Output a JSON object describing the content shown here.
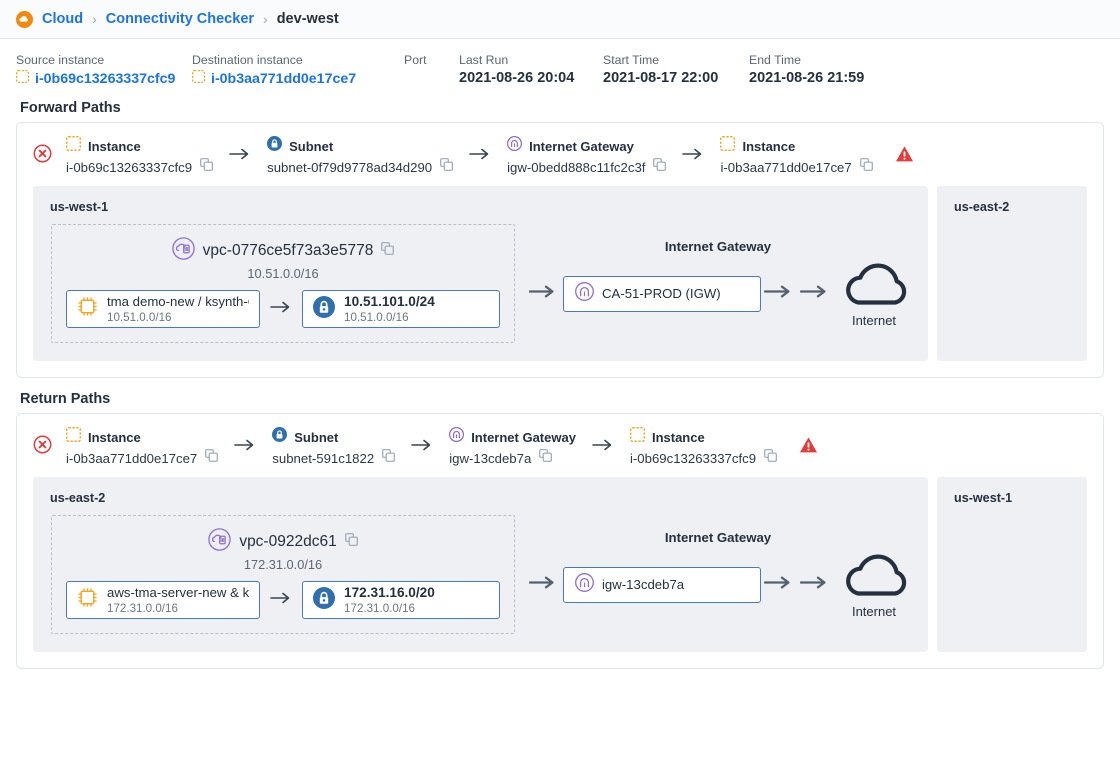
{
  "breadcrumb": {
    "logo_icon": "cloud-logo-icon",
    "items": [
      {
        "label": "Cloud",
        "type": "link"
      },
      {
        "label": "Connectivity Checker",
        "type": "link"
      },
      {
        "label": "dev-west",
        "type": "current"
      }
    ],
    "separator": "›"
  },
  "meta": {
    "source": {
      "label": "Source instance",
      "value": "i-0b69c13263337cfc9",
      "icon": "instance-icon"
    },
    "destination": {
      "label": "Destination instance",
      "value": "i-0b3aa771dd0e17ce7",
      "icon": "instance-icon"
    },
    "port": {
      "label": "Port",
      "value": ""
    },
    "last_run": {
      "label": "Last Run",
      "value": "2021-08-26 20:04"
    },
    "start_time": {
      "label": "Start Time",
      "value": "2021-08-17 22:00"
    },
    "end_time": {
      "label": "End Time",
      "value": "2021-08-26 21:59"
    }
  },
  "forward": {
    "title": "Forward Paths",
    "status_icon": "error-circle-icon",
    "warning_icon": "warning-triangle-icon",
    "hops": [
      {
        "type": "Instance",
        "id": "i-0b69c13263337cfc9",
        "icon": "instance-icon"
      },
      {
        "type": "Subnet",
        "id": "subnet-0f79d9778ad34d290",
        "icon": "subnet-lock-icon"
      },
      {
        "type": "Internet Gateway",
        "id": "igw-0bedd888c11fc2c3f",
        "icon": "internet-gateway-icon"
      },
      {
        "type": "Instance",
        "id": "i-0b3aa771dd0e17ce7",
        "icon": "instance-icon"
      }
    ],
    "region": "us-west-1",
    "vpc": {
      "name": "vpc-0776ce5f73a3e5778",
      "cidr": "10.51.0.0/16",
      "icon": "vpc-icon"
    },
    "instance_node": {
      "name": "tma demo-new / ksynth-CA",
      "cidr": "10.51.0.0/16",
      "icon": "instance-chip-icon"
    },
    "subnet_node": {
      "name": "10.51.101.0/24",
      "cidr": "10.51.0.0/16",
      "icon": "subnet-lock-icon"
    },
    "igw": {
      "label": "Internet Gateway",
      "name": "CA-51-PROD (IGW)",
      "icon": "internet-gateway-icon"
    },
    "internet": {
      "label": "Internet",
      "icon": "cloud-icon"
    },
    "peer_region": "us-east-2"
  },
  "return": {
    "title": "Return Paths",
    "status_icon": "error-circle-icon",
    "warning_icon": "warning-triangle-icon",
    "hops": [
      {
        "type": "Instance",
        "id": "i-0b3aa771dd0e17ce7",
        "icon": "instance-icon"
      },
      {
        "type": "Subnet",
        "id": "subnet-591c1822",
        "icon": "subnet-lock-icon"
      },
      {
        "type": "Internet Gateway",
        "id": "igw-13cdeb7a",
        "icon": "internet-gateway-icon"
      },
      {
        "type": "Instance",
        "id": "i-0b69c13263337cfc9",
        "icon": "instance-icon"
      }
    ],
    "region": "us-east-2",
    "vpc": {
      "name": "vpc-0922dc61",
      "cidr": "172.31.0.0/16",
      "icon": "vpc-icon"
    },
    "instance_node": {
      "name": "aws-tma-server-new & ksynth-VA",
      "cidr": "172.31.0.0/16",
      "icon": "instance-chip-icon"
    },
    "subnet_node": {
      "name": "172.31.16.0/20",
      "cidr": "172.31.0.0/16",
      "icon": "subnet-lock-icon"
    },
    "igw": {
      "label": "Internet Gateway",
      "name": "igw-13cdeb7a",
      "icon": "internet-gateway-icon"
    },
    "internet": {
      "label": "Internet",
      "icon": "cloud-icon"
    },
    "peer_region": "us-west-1"
  },
  "colors": {
    "link_blue": "#1a73e8",
    "instance_orange": "#f5a623",
    "subnet_blue": "#2f6fad",
    "gateway_purple": "#8e6ed6",
    "error_red": "#e23c3c",
    "region_bg": "#eef0f4",
    "arrow_grey": "#4a5a6a"
  },
  "icons": {
    "copy": "copy-icon"
  }
}
